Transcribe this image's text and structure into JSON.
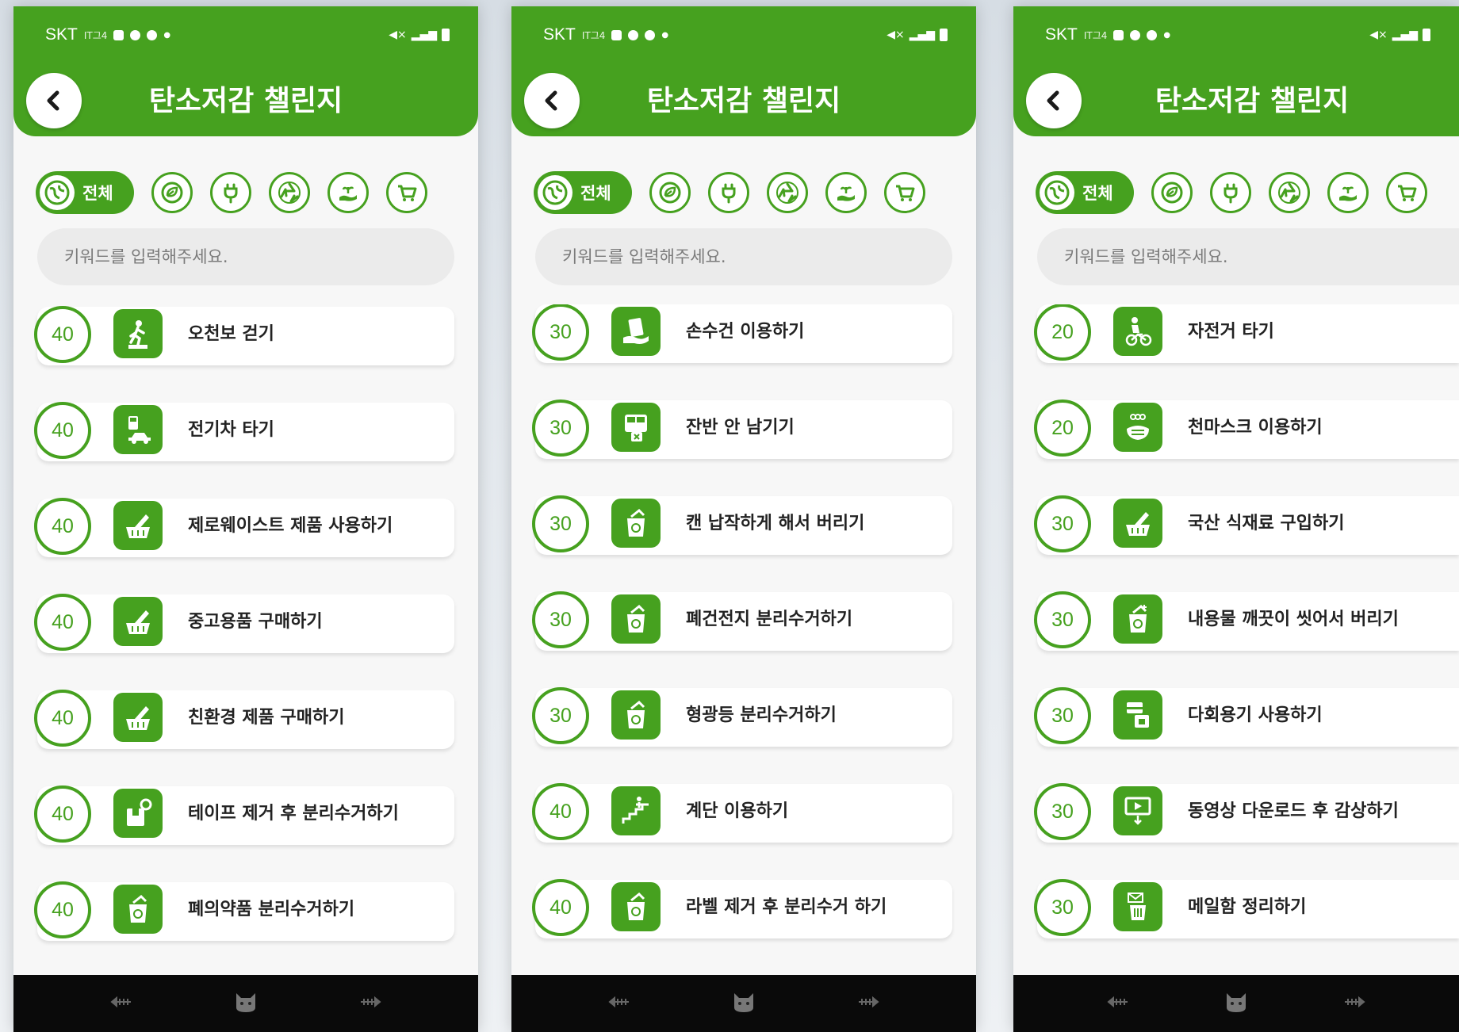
{
  "colors": {
    "accent": "#46a11f",
    "bar": "#0a0a0a"
  },
  "status": {
    "carrier": "SKT",
    "mini": "IT그4"
  },
  "header": {
    "title": "탄소저감 챌린지"
  },
  "filter": {
    "all_label": "전체",
    "icons": [
      "leaf-icon",
      "plug-icon",
      "recycle-icon",
      "hand-plant-icon",
      "cart-icon"
    ]
  },
  "search": {
    "placeholder": "키워드를 입력해주세요."
  },
  "screens": [
    {
      "items": [
        {
          "points": "40",
          "label": "오천보 걷기",
          "icon": "walking-icon"
        },
        {
          "points": "40",
          "label": "전기차 타기",
          "icon": "electric-car-icon"
        },
        {
          "points": "40",
          "label": "제로웨이스트 제품 사용하기",
          "icon": "basket-icon"
        },
        {
          "points": "40",
          "label": "중고용품 구매하기",
          "icon": "basket-icon"
        },
        {
          "points": "40",
          "label": "친환경 제품 구매하기",
          "icon": "basket-icon"
        },
        {
          "points": "40",
          "label": "테이프 제거 후 분리수거하기",
          "icon": "box-icon"
        },
        {
          "points": "40",
          "label": "폐의약품 분리수거하기",
          "icon": "recycle-bin-icon"
        }
      ]
    },
    {
      "items": [
        {
          "points": "30",
          "label": "손수건 이용하기",
          "icon": "handkerchief-icon"
        },
        {
          "points": "30",
          "label": "잔반 안 남기기",
          "icon": "food-tray-icon"
        },
        {
          "points": "30",
          "label": "캔 납작하게 해서 버리기",
          "icon": "recycle-bin-icon"
        },
        {
          "points": "30",
          "label": "폐건전지 분리수거하기",
          "icon": "recycle-bin-icon"
        },
        {
          "points": "30",
          "label": "형광등 분리수거하기",
          "icon": "recycle-bin-icon"
        },
        {
          "points": "40",
          "label": "계단 이용하기",
          "icon": "stairs-icon"
        },
        {
          "points": "40",
          "label": "라벨 제거 후 분리수거 하기",
          "icon": "recycle-bin-icon"
        }
      ]
    },
    {
      "items": [
        {
          "points": "20",
          "label": "자전거 타기",
          "icon": "bicycle-icon"
        },
        {
          "points": "20",
          "label": "천마스크 이용하기",
          "icon": "mask-icon"
        },
        {
          "points": "30",
          "label": "국산 식재료 구입하기",
          "icon": "basket-icon"
        },
        {
          "points": "30",
          "label": "내용물 깨끗이 씻어서 버리기",
          "icon": "recycle-bin-icon"
        },
        {
          "points": "30",
          "label": "다회용기 사용하기",
          "icon": "container-icon"
        },
        {
          "points": "30",
          "label": "동영상 다운로드 후 감상하기",
          "icon": "video-download-icon"
        },
        {
          "points": "30",
          "label": "메일함 정리하기",
          "icon": "mail-trash-icon"
        }
      ]
    }
  ],
  "nav": [
    "fish-bone-icon",
    "cat-face-icon",
    "fish-bone-icon"
  ]
}
